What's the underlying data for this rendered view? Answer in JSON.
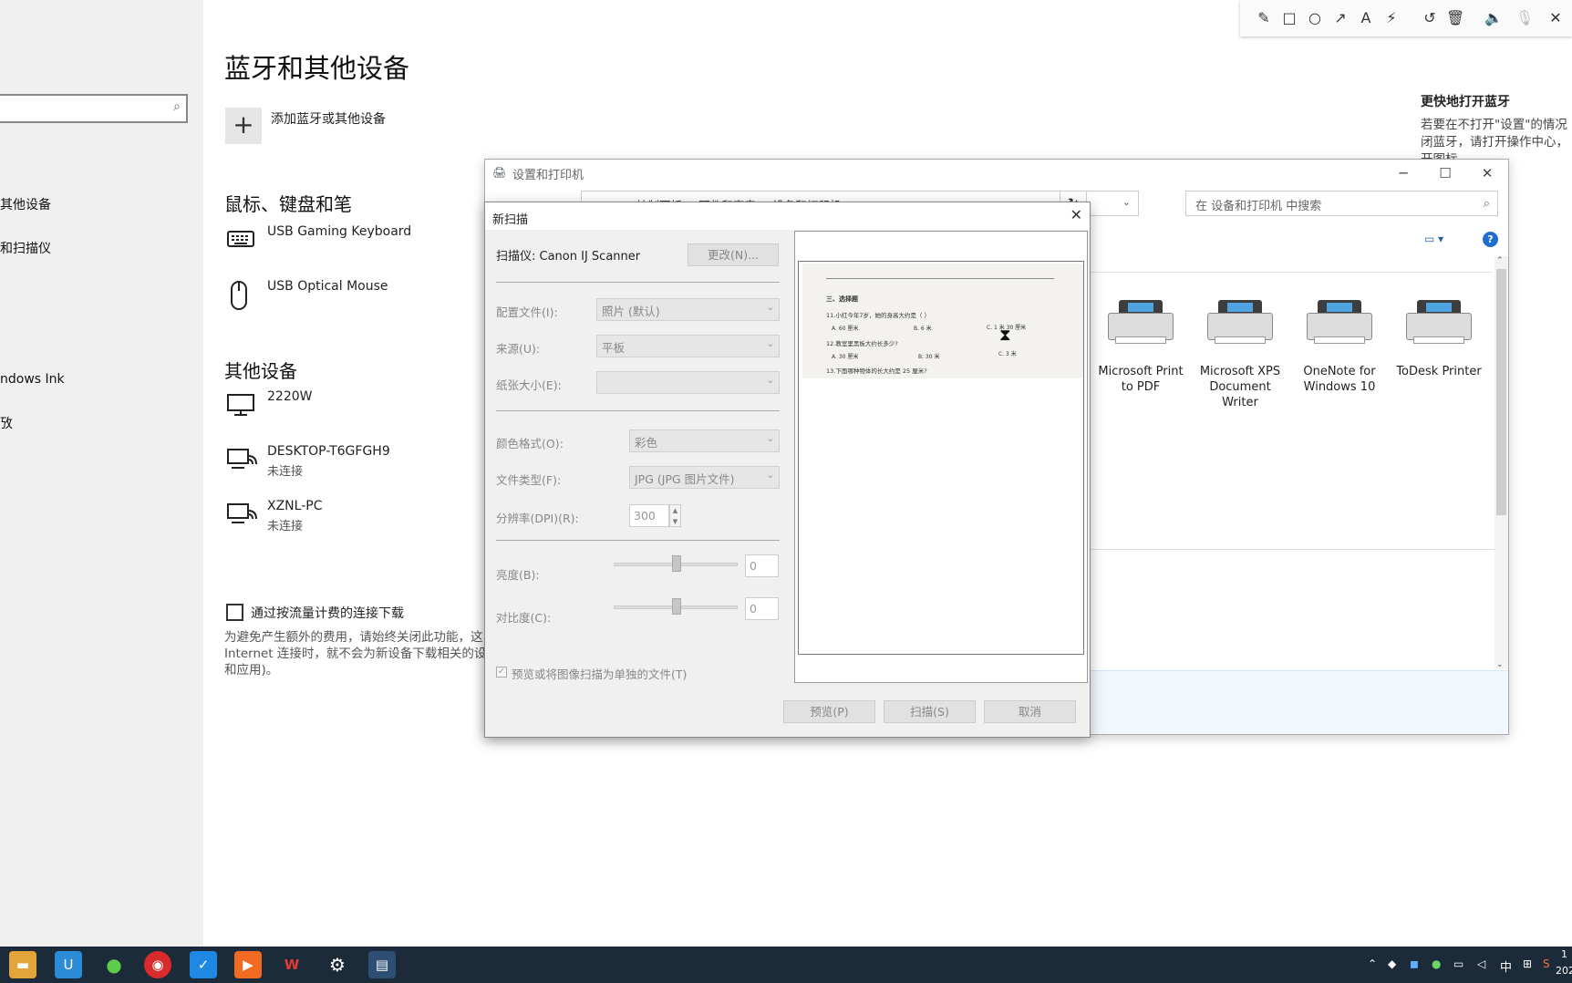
{
  "settings": {
    "page_title": "蓝牙和其他设备",
    "add_device_label": "添加蓝牙或其他设备",
    "nav_items": [
      "其他设备",
      "和扫描仪",
      "ndows Ink",
      "攷"
    ],
    "section_mouse": "鼠标、键盘和笔",
    "devices_input": [
      {
        "name": "USB Gaming Keyboard",
        "icon": "keyboard-icon"
      },
      {
        "name": "USB Optical Mouse",
        "icon": "mouse-icon"
      }
    ],
    "section_other": "其他设备",
    "devices_other": [
      {
        "name": "2220W",
        "status": "",
        "icon": "monitor-icon"
      },
      {
        "name": "DESKTOP-T6GFGH9",
        "status": "未连接",
        "icon": "network-device-icon"
      },
      {
        "name": "XZNL-PC",
        "status": "未连接",
        "icon": "network-device-icon"
      }
    ],
    "metered_label": "通过按流量计费的连接下载",
    "metered_desc": "为避免产生额外的费用，请始终关闭此功能，这 Internet 连接时，就不会为新设备下载相关的设 和应用)。",
    "right_heading": "更快地打开蓝牙",
    "right_desc": "若要在不打开\"设置\"的情况 闭蓝牙，请打开操作中心， 开图标"
  },
  "annotation_toolbar": {
    "icons": [
      "pencil-icon",
      "rectangle-icon",
      "circle-icon",
      "arrow-icon",
      "text-icon",
      "magic-wand-icon",
      "undo-icon",
      "delete-icon",
      "volume-icon",
      "mic-icon",
      "close-icon"
    ]
  },
  "devices_window": {
    "title": "设置和打印机",
    "breadcrumb": "控制面板  >  硬件和声音  >  设备和打印机",
    "search_placeholder": "在 设备和打印机 中搜索",
    "printers": [
      {
        "name": "Microsoft Print to PDF"
      },
      {
        "name": "Microsoft XPS Document Writer"
      },
      {
        "name": "OneNote for Windows 10"
      },
      {
        "name": "ToDesk Printer"
      }
    ]
  },
  "scan_dialog": {
    "title": "新扫描",
    "scanner_label": "扫描仪: Canon IJ Scanner",
    "change_button": "更改(N)...",
    "profile_label": "配置文件(I):",
    "profile_value": "照片 (默认)",
    "source_label": "来源(U):",
    "source_value": "平板",
    "paper_label": "纸张大小(E):",
    "paper_value": "",
    "color_label": "颜色格式(O):",
    "color_value": "彩色",
    "filetype_label": "文件类型(F):",
    "filetype_value": "JPG (JPG 图片文件)",
    "dpi_label": "分辨率(DPI)(R):",
    "dpi_value": "300",
    "brightness_label": "亮度(B):",
    "brightness_value": "0",
    "contrast_label": "对比度(C):",
    "contrast_value": "0",
    "separate_files_label": "预览或将图像扫描为单独的文件(T)",
    "preview_button": "预览(P)",
    "scan_button": "扫描(S)",
    "cancel_button": "取消",
    "preview_text": {
      "heading": "三、选择题",
      "q11": "11.小红今年7岁，她的身高大约是（  ）",
      "q11_a": "A. 60 厘米",
      "q11_b": "B. 6 米",
      "q11_c": "C. 1 米 30 厘米",
      "q12": "12.教室里黑板大约长多少?",
      "q12_a": "A. 30 厘米",
      "q12_b": "B. 30 米",
      "q12_c": "C. 3 米",
      "q13": "13.下面哪种物体的长大约是 25 厘米?"
    }
  },
  "taskbar": {
    "apps": [
      "file-explorer-icon",
      "ucloud-icon",
      "wechat-icon",
      "netease-music-icon",
      "todo-icon",
      "foxit-icon",
      "wps-icon",
      "settings-icon",
      "devices-icon"
    ],
    "ime": "中",
    "clock_partial": "1",
    "date_partial": "202"
  }
}
